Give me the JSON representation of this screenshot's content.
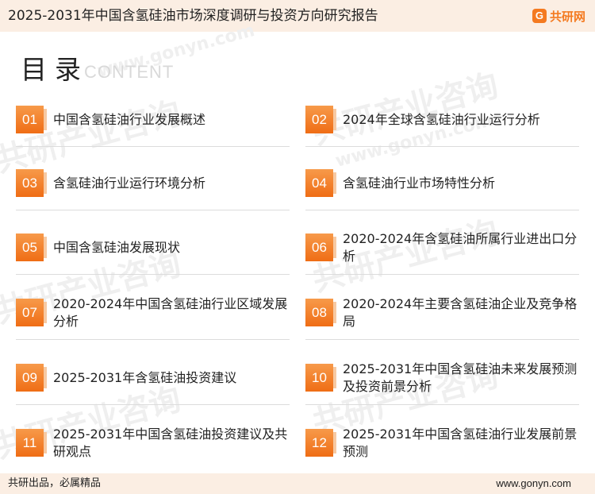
{
  "header": {
    "title": "2025-2031年中国含氢硅油市场深度调研与投资方向研究报告",
    "brand_mark": "G",
    "brand_text": "共研网"
  },
  "toc": {
    "title": "目录",
    "subtitle": "CONTENT",
    "items": [
      {
        "num": "01",
        "text": "中国含氢硅油行业发展概述"
      },
      {
        "num": "02",
        "text": "2024年全球含氢硅油行业运行分析"
      },
      {
        "num": "03",
        "text": "含氢硅油行业运行环境分析"
      },
      {
        "num": "04",
        "text": "含氢硅油行业市场特性分析"
      },
      {
        "num": "05",
        "text": "中国含氢硅油发展现状"
      },
      {
        "num": "06",
        "text": "2020-2024年含氢硅油所属行业进出口分析"
      },
      {
        "num": "07",
        "text": "2020-2024年中国含氢硅油行业区域发展分析"
      },
      {
        "num": "08",
        "text": "2020-2024年主要含氢硅油企业及竞争格局"
      },
      {
        "num": "09",
        "text": "2025-2031年含氢硅油投资建议"
      },
      {
        "num": "10",
        "text": "2025-2031年中国含氢硅油未来发展预测及投资前景分析"
      },
      {
        "num": "11",
        "text": "2025-2031年中国含氢硅油投资建议及共研观点"
      },
      {
        "num": "12",
        "text": "2025-2031年中国含氢硅油行业发展前景预测"
      }
    ]
  },
  "watermark": {
    "text": "共研产业咨询",
    "url": "www.gonyn.com"
  },
  "footer": {
    "slogan": "共研出品，必属精品",
    "url": "www.gonyn.com"
  },
  "colors": {
    "accent": "#f47a20",
    "band": "#fbeee3"
  }
}
